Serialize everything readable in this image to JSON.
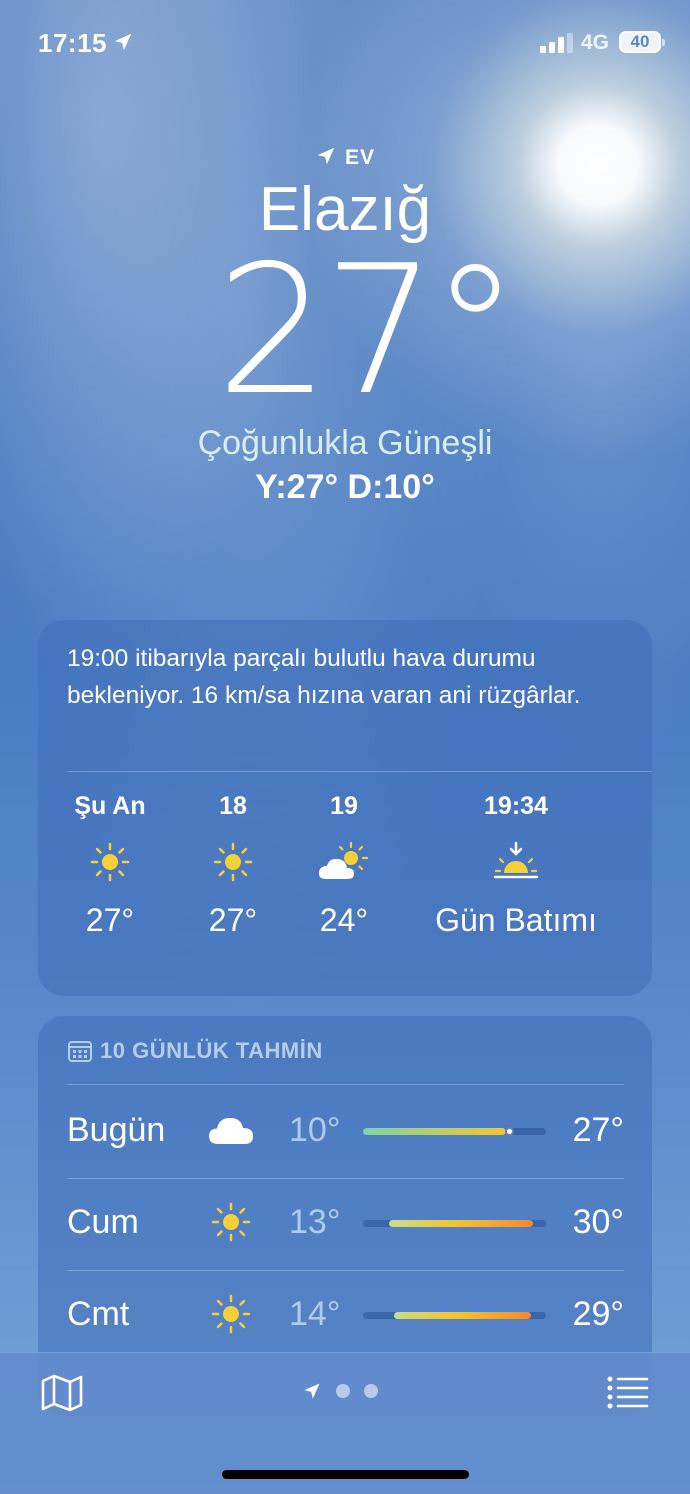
{
  "status_bar": {
    "time": "17:15",
    "network": "4G",
    "battery": "40"
  },
  "location": {
    "label": "EV",
    "city": "Elazığ"
  },
  "current": {
    "temperature": "27°",
    "condition": "Çoğunlukla Güneşli",
    "high_low": "Y:27° D:10°"
  },
  "hourly": {
    "summary": "19:00 itibarıyla parçalı bulutlu hava durumu bekleniyor. 16 km/sa hızına varan ani rüzgârlar.",
    "items": [
      {
        "label": "Şu An",
        "icon": "sun-icon",
        "value": "27°"
      },
      {
        "label": "18",
        "icon": "sun-icon",
        "value": "27°"
      },
      {
        "label": "19",
        "icon": "partly-cloudy-icon",
        "value": "24°"
      },
      {
        "label": "19:34",
        "icon": "sunset-icon",
        "value": "Gün Batımı"
      }
    ]
  },
  "daily": {
    "header": "10 GÜNLÜK TAHMİN",
    "rows": [
      {
        "day": "Bugün",
        "icon": "cloud-icon",
        "low": "10°",
        "high": "27°",
        "range": [
          0.0,
          0.78
        ],
        "current": 0.8
      },
      {
        "day": "Cum",
        "icon": "sun-icon",
        "low": "13°",
        "high": "30°",
        "range": [
          0.14,
          0.93
        ]
      },
      {
        "day": "Cmt",
        "icon": "sun-icon",
        "low": "14°",
        "high": "29°",
        "range": [
          0.17,
          0.92
        ]
      }
    ]
  },
  "colors": {
    "sun": "#f7d038",
    "bar_cool": "#7fd4a8",
    "bar_warm": "#f4c531",
    "bar_hot": "#f08a33"
  }
}
